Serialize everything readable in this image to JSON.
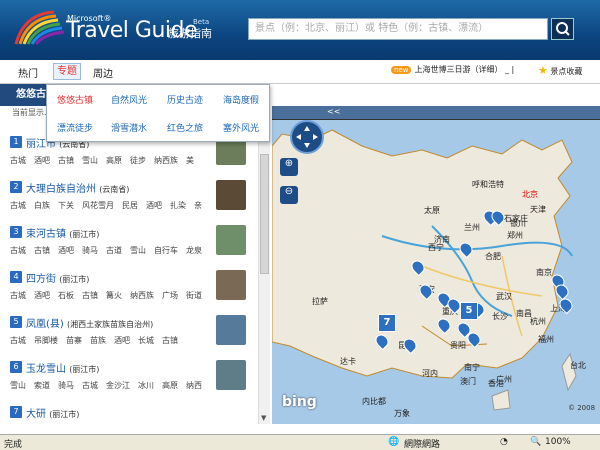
{
  "header": {
    "ms": "Microsoft®",
    "brand": "Travel Guide",
    "brand_cn": "旅游指南",
    "beta": "Beta",
    "search_placeholder": "景点（例：北京、丽江）或 特色（例：古镇、漂流）"
  },
  "nav": {
    "hot": "热门",
    "topic": "专题",
    "near": "周边"
  },
  "promo": {
    "badge": "new",
    "text": "上海世博三日游（详细）"
  },
  "fav": "景点收藏",
  "left": {
    "title": "悠悠古...",
    "sub": "当前显示..."
  },
  "dropdown": [
    "悠悠古镇",
    "自然风光",
    "历史古迹",
    "海岛度假",
    "漂流徒步",
    "滑雪潜水",
    "红色之旅",
    "塞外风光"
  ],
  "items": [
    {
      "n": "1",
      "name": "丽江市",
      "prov": "(云南省)",
      "tags": "古城　酒吧　古镇　雪山　高原　徒步　纳西族　美"
    },
    {
      "n": "2",
      "name": "大理白族自治州",
      "prov": "(云南省)",
      "tags": "古城　白族　下关　风花雪月　民居　酒吧　扎染　亲"
    },
    {
      "n": "3",
      "name": "束河古镇",
      "prov": "(丽江市)",
      "tags": "古城　古镇　酒吧　骑马　古道　雪山　自行车　龙泉"
    },
    {
      "n": "4",
      "name": "四方街",
      "prov": "(丽江市)",
      "tags": "古城　酒吧　石板　古镇　篝火　纳西族　广场　街道"
    },
    {
      "n": "5",
      "name": "凤凰(县)",
      "prov": "(湘西土家族苗族自治州)",
      "tags": "古城　吊脚楼　苗寨　苗族　酒吧　长城　古镇"
    },
    {
      "n": "6",
      "name": "玉龙雪山",
      "prov": "(丽江市)",
      "tags": "雪山　索道　骑马　古城　金沙江　冰川　高原　纳西"
    },
    {
      "n": "7",
      "name": "大研",
      "prov": "(丽江市)",
      "tags": ""
    }
  ],
  "map": {
    "collapse": "<<",
    "cities": [
      "呼和浩特",
      "北京",
      "天津",
      "石家庄",
      "银川",
      "太原",
      "济南",
      "西宁",
      "兰州",
      "郑州",
      "西安",
      "合肥",
      "南京",
      "武汉",
      "上海",
      "拉萨",
      "重庆",
      "长沙",
      "杭州",
      "南昌",
      "贵阳",
      "福州",
      "昆明",
      "南宁",
      "广州",
      "台北",
      "达卡",
      "河内",
      "澳门",
      "香港",
      "内比都",
      "万象"
    ],
    "cluster_a": "7",
    "cluster_b": "5",
    "logo": "bing",
    "copy": "© 2008"
  },
  "status": {
    "done": "完成",
    "zone": "網際網路",
    "zoom": "100%"
  }
}
